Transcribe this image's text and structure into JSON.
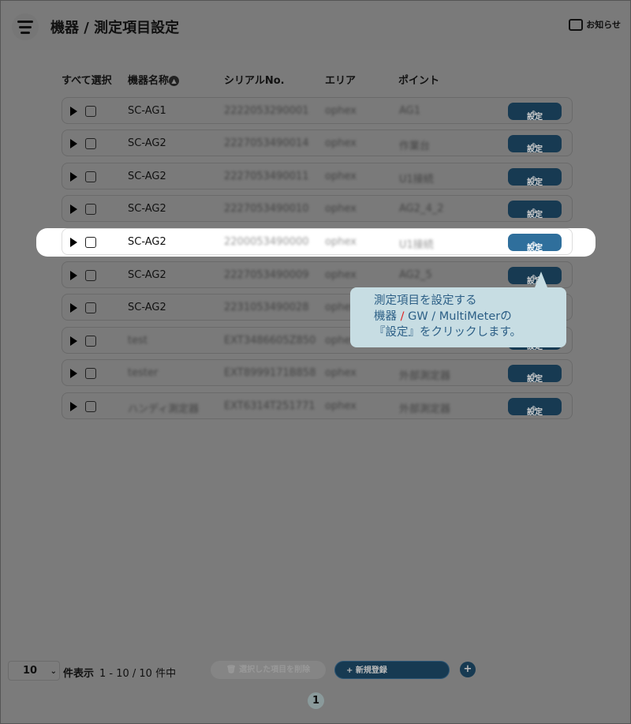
{
  "header": {
    "title": "機器 / 測定項目設定",
    "notice": "お知らせ"
  },
  "columns": {
    "select_all": "すべて選択",
    "name": "機器名称",
    "serial": "シリアルNo.",
    "area": "エリア",
    "point": "ポイント"
  },
  "rows": [
    {
      "name": "SC-AG1",
      "serial": "2222053290001",
      "area": "ophex",
      "point": "AG1",
      "blurred_name": false
    },
    {
      "name": "SC-AG2",
      "serial": "2227053490014",
      "area": "ophex",
      "point": "作業台",
      "blurred_name": false
    },
    {
      "name": "SC-AG2",
      "serial": "2227053490011",
      "area": "ophex",
      "point": "U1接続",
      "blurred_name": false
    },
    {
      "name": "SC-AG2",
      "serial": "2227053490010",
      "area": "ophex",
      "point": "AG2_4_2",
      "blurred_name": false
    },
    {
      "name": "SC-AG2",
      "serial": "2200053490000",
      "area": "ophex",
      "point": "U1接続",
      "blurred_name": false,
      "highlighted": true
    },
    {
      "name": "SC-AG2",
      "serial": "2227053490009",
      "area": "ophex",
      "point": "AG2_5",
      "blurred_name": false
    },
    {
      "name": "SC-AG2",
      "serial": "2231053490028",
      "area": "ophex",
      "point": "",
      "blurred_name": false
    },
    {
      "name": "test",
      "serial": "EXT3486605Z850",
      "area": "ophex",
      "point": "",
      "blurred_name": true
    },
    {
      "name": "tester",
      "serial": "EXT8999171B858",
      "area": "ophex",
      "point": "外部測定器",
      "blurred_name": true
    },
    {
      "name": "ハンディ測定器",
      "serial": "EXT6314T251771",
      "area": "ophex",
      "point": "外部測定器",
      "blurred_name": true
    }
  ],
  "settings_label": "設定",
  "tooltip": {
    "line1": "測定項目を設定する",
    "line2a": "機器",
    "slash": "/",
    "line2b": "GW / MultiMeterの",
    "line3": "『設定』をクリックします。",
    "slash_color": "#e02020"
  },
  "footer": {
    "per_page": "10",
    "per_page_label": "件表示",
    "range": "1 - 10 / 10 件中",
    "delete": "選択した項目を削除",
    "new": "+ 新規登録",
    "plus": "+",
    "page": "1"
  }
}
